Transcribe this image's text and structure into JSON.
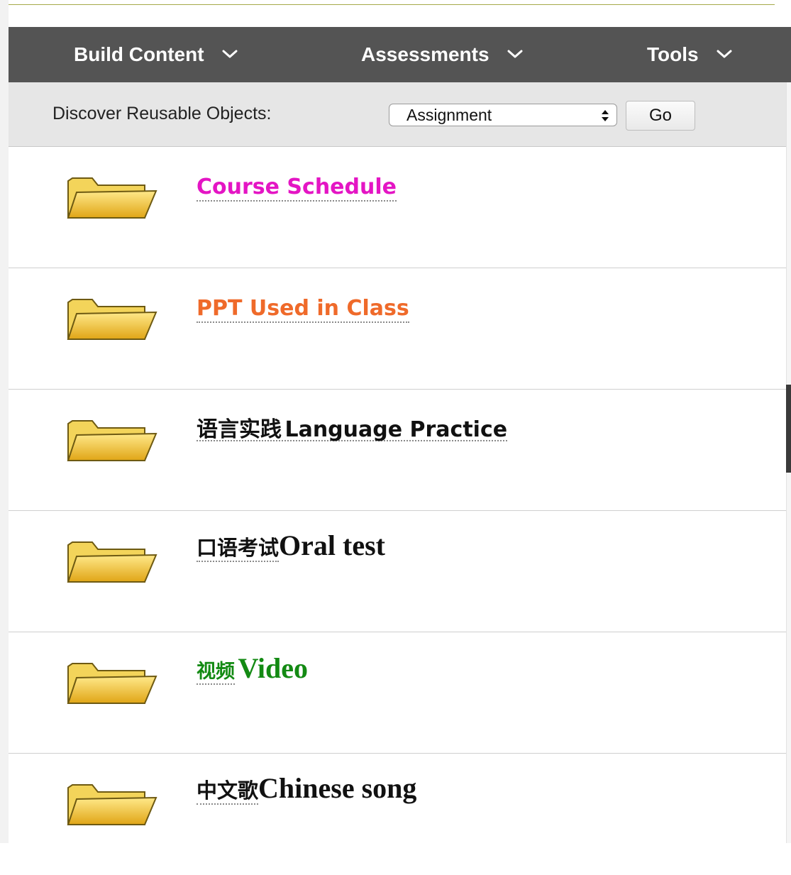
{
  "toolbar": {
    "menus": [
      {
        "label": "Build Content"
      },
      {
        "label": "Assessments"
      },
      {
        "label": "Tools"
      }
    ]
  },
  "discover": {
    "label": "Discover Reusable Objects:",
    "selected": "Assignment",
    "go_label": "Go"
  },
  "items": [
    {
      "zh": "",
      "en": "Course Schedule",
      "color": "#e415c4"
    },
    {
      "zh": "",
      "en": "PPT Used in Class",
      "color": "#ef6a2a"
    },
    {
      "zh": "语言实践",
      "en": "Language Practice",
      "color": "#111111"
    },
    {
      "zh": "口语考试",
      "en": "Oral test",
      "color": "#111111"
    },
    {
      "zh": "视频",
      "en": "Video",
      "color": "#138a13"
    },
    {
      "zh": "中文歌",
      "en": "Chinese song",
      "color": "#111111"
    }
  ],
  "icons": {
    "menu_chevron": "chevron-down-icon",
    "select_arrows": "select-arrows-icon",
    "folder": "folder-icon"
  }
}
